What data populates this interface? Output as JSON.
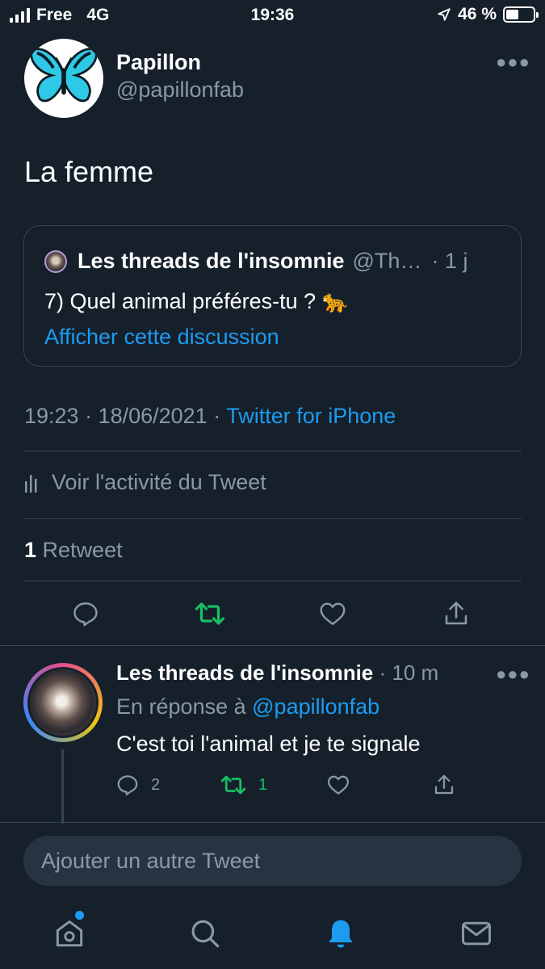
{
  "status_bar": {
    "carrier": "Free",
    "network": "4G",
    "time": "19:36",
    "battery": "46 %",
    "battery_level_percent": 46
  },
  "tweet": {
    "author_name": "Papillon",
    "author_handle": "@papillonfab",
    "text": "La femme",
    "quoted": {
      "author_name": "Les threads de l'insomnie",
      "author_handle": "@Th…",
      "time": "· 1 j",
      "text": "7) Quel animal préféres-tu ? 🐆",
      "show_thread_link": "Afficher cette discussion"
    },
    "timestamp": "19:23 · 18/06/2021 ·",
    "client": "Twitter for iPhone",
    "activity_label": "Voir l'activité du Tweet",
    "retweet_count": "1",
    "retweet_label": "Retweet"
  },
  "reply": {
    "author_name": "Les threads de l'insomnie",
    "time": "· 10 m",
    "replying_to_prefix": "En réponse à",
    "replying_to_handle": "@papillonfab",
    "text": "C'est toi l'animal et je te signale",
    "reply_count": "2",
    "retweet_count": "1"
  },
  "composer": {
    "placeholder": "Ajouter un autre Tweet"
  },
  "colors": {
    "background": "#15202b",
    "accent_blue": "#1d9bf0",
    "retweet_green": "#17bf63",
    "muted": "#8b98a5",
    "border": "#38444d"
  },
  "icons": [
    "more-icon",
    "chart-icon",
    "reply-icon",
    "retweet-icon",
    "like-icon",
    "share-icon",
    "home-icon",
    "search-icon",
    "notifications-icon",
    "messages-icon",
    "location-arrow-icon"
  ]
}
